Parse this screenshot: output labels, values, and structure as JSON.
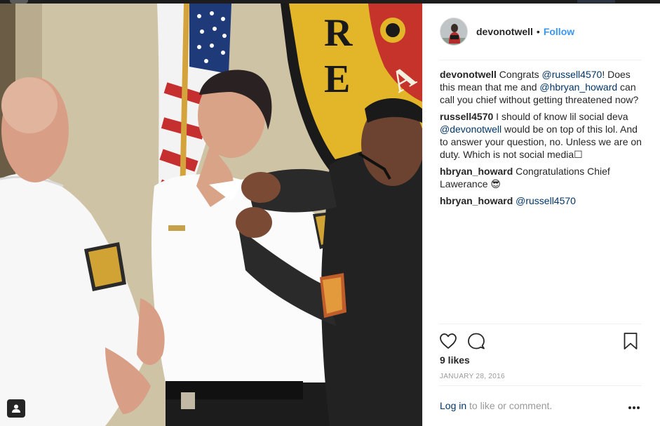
{
  "post": {
    "author": "devonotwell",
    "dot": "•",
    "follow_label": "Follow",
    "likes": "9 likes",
    "date": "JANUARY 28, 2016",
    "login_link": "Log in",
    "login_rest": " to like or comment."
  },
  "comments": [
    {
      "user": "devonotwell",
      "parts": [
        {
          "t": " Congrats ",
          "m": false
        },
        {
          "t": "@russell4570",
          "m": true
        },
        {
          "t": "! Does this mean that me and ",
          "m": false
        },
        {
          "t": "@hbryan_howard",
          "m": true
        },
        {
          "t": " can call you chief without getting threatened now?",
          "m": false
        }
      ]
    },
    {
      "user": "russell4570",
      "parts": [
        {
          "t": " I should of know lil social deva ",
          "m": false
        },
        {
          "t": "@devonotwell",
          "m": true
        },
        {
          "t": " would be on top of this lol. And to answer your question, no. Unless we are on duty. Which is not social media☐",
          "m": false
        }
      ]
    },
    {
      "user": "hbryan_howard",
      "parts": [
        {
          "t": " Congratulations Chief Lawerance 😎",
          "m": false
        }
      ]
    },
    {
      "user": "hbryan_howard",
      "parts": [
        {
          "t": " ",
          "m": false
        },
        {
          "t": "@russell4570",
          "m": true
        }
      ]
    }
  ],
  "icons": {
    "like": "heart-icon",
    "comment": "comment-bubble-icon",
    "save": "bookmark-icon",
    "more": "more-options-icon",
    "tag": "user-tag-icon"
  },
  "colors": {
    "follow": "#3897f0",
    "mention": "#003569",
    "muted": "#999999"
  },
  "photo": {
    "sign_letters": [
      "R",
      "E",
      "A"
    ]
  }
}
